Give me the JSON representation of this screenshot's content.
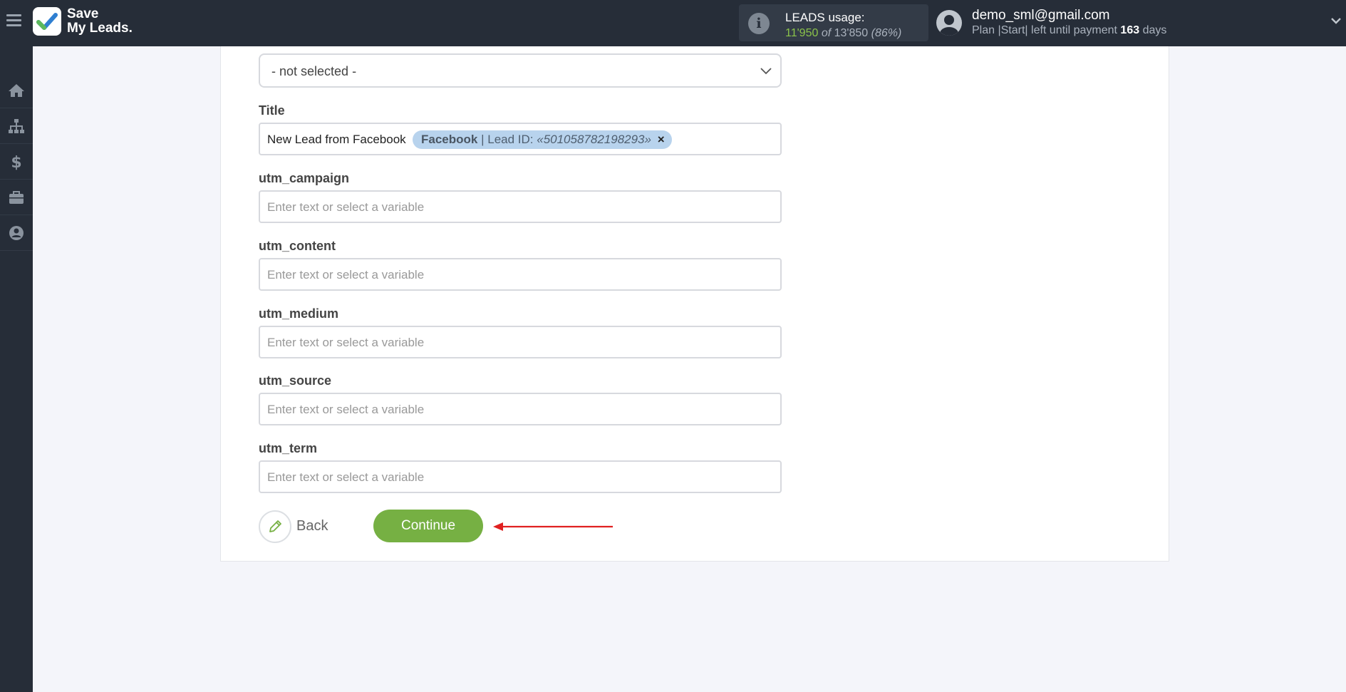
{
  "header": {
    "logo_line1": "Save",
    "logo_line2": "My Leads.",
    "usage_label": "LEADS usage:",
    "usage_used": "11'950",
    "usage_of": "of",
    "usage_total": "13'850",
    "usage_percent": "(86%)",
    "user_email": "demo_sml@gmail.com",
    "plan_text": "Plan |Start| left until payment",
    "plan_days": "163",
    "plan_days_suffix": "days"
  },
  "sidebar": {
    "items": [
      {
        "icon": "home-icon"
      },
      {
        "icon": "sitemap-icon"
      },
      {
        "icon": "dollar-icon"
      },
      {
        "icon": "briefcase-icon"
      },
      {
        "icon": "user-circle-icon"
      }
    ]
  },
  "form": {
    "select_value": "- not selected -",
    "title_label": "Title",
    "title_text": "New Lead from Facebook",
    "title_chip_source": "Facebook",
    "title_chip_field": "| Lead ID:",
    "title_chip_value": "«501058782198293»",
    "title_chip_remove": "×",
    "fields": [
      {
        "label": "utm_campaign",
        "placeholder": "Enter text or select a variable"
      },
      {
        "label": "utm_content",
        "placeholder": "Enter text or select a variable"
      },
      {
        "label": "utm_medium",
        "placeholder": "Enter text or select a variable"
      },
      {
        "label": "utm_source",
        "placeholder": "Enter text or select a variable"
      },
      {
        "label": "utm_term",
        "placeholder": "Enter text or select a variable"
      }
    ],
    "back_label": "Back",
    "continue_label": "Continue"
  },
  "colors": {
    "topbar": "#262d38",
    "accent_green": "#76b043",
    "chip_bg": "#b8d3ed",
    "arrow_red": "#e02020"
  }
}
